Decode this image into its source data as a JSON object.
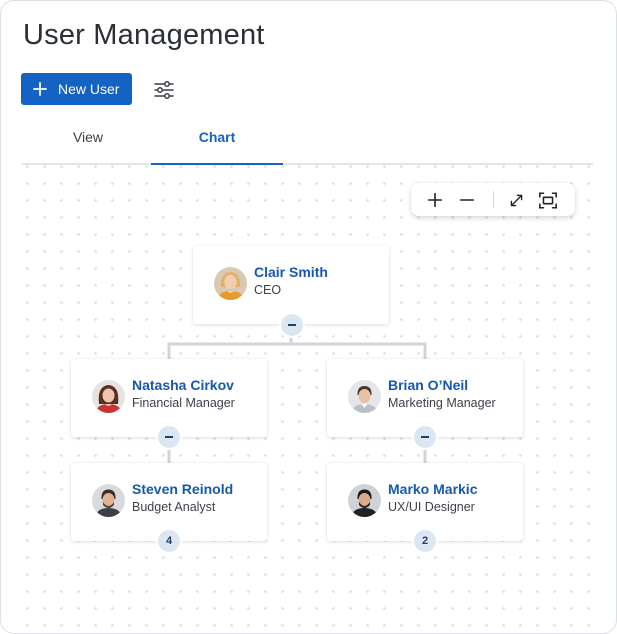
{
  "header": {
    "title": "User Management"
  },
  "toolbar": {
    "new_user_label": "New User",
    "filter_icon": "sliders-icon"
  },
  "tabs": [
    {
      "label": "View",
      "active": false
    },
    {
      "label": "Chart",
      "active": true
    }
  ],
  "zoom_toolbar": {
    "icons": [
      "plus-icon",
      "minus-icon",
      "expand-icon",
      "fit-screen-icon"
    ]
  },
  "org_chart": {
    "root": {
      "name": "Clair Smith",
      "role": "CEO"
    },
    "managers": [
      {
        "name": "Natasha Cirkov",
        "role": "Financial Manager"
      },
      {
        "name": "Brian O’Neil",
        "role": "Marketing Manager"
      }
    ],
    "reports": [
      {
        "name": "Steven Reinold",
        "role": "Budget Analyst",
        "count": "4"
      },
      {
        "name": "Marko Markic",
        "role": "UX/UI Designer",
        "count": "2"
      }
    ]
  },
  "colors": {
    "primary": "#1462c4",
    "name_text": "#1558b0",
    "badge_bg": "#dbe6f3",
    "connector": "#d0d5dc"
  }
}
